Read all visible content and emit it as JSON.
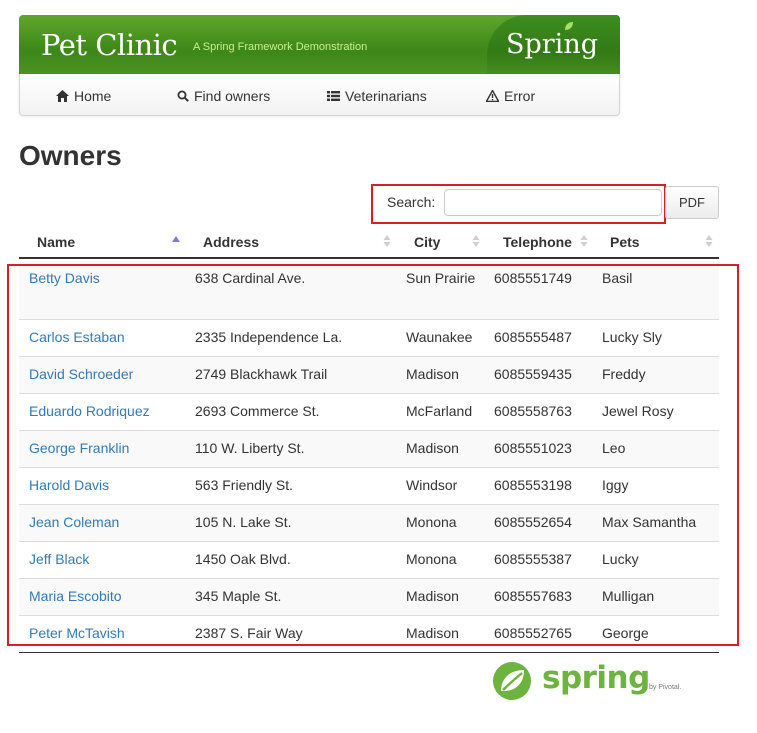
{
  "banner": {
    "title": "Pet Clinic",
    "subtitle": "A Spring Framework Demonstration",
    "logo_text": "Spring"
  },
  "nav": {
    "items": [
      {
        "label": "Home",
        "icon": "home-icon"
      },
      {
        "label": "Find owners",
        "icon": "search-icon"
      },
      {
        "label": "Veterinarians",
        "icon": "list-icon"
      },
      {
        "label": "Error",
        "icon": "warning-icon"
      }
    ]
  },
  "page": {
    "title": "Owners"
  },
  "search": {
    "label": "Search:",
    "value": "",
    "placeholder": ""
  },
  "toolbar": {
    "pdf_label": "PDF"
  },
  "table": {
    "columns": [
      "Name",
      "Address",
      "City",
      "Telephone",
      "Pets"
    ],
    "sorted_column": "Name",
    "rows": [
      {
        "name": "Betty Davis",
        "address": "638 Cardinal Ave.",
        "city": "Sun Prairie",
        "telephone": "6085551749",
        "pets": "Basil"
      },
      {
        "name": "Carlos Estaban",
        "address": "2335 Independence La.",
        "city": "Waunakee",
        "telephone": "6085555487",
        "pets": "Lucky Sly"
      },
      {
        "name": "David Schroeder",
        "address": "2749 Blackhawk Trail",
        "city": "Madison",
        "telephone": "6085559435",
        "pets": "Freddy"
      },
      {
        "name": "Eduardo Rodriquez",
        "address": "2693 Commerce St.",
        "city": "McFarland",
        "telephone": "6085558763",
        "pets": "Jewel Rosy"
      },
      {
        "name": "George Franklin",
        "address": "110 W. Liberty St.",
        "city": "Madison",
        "telephone": "6085551023",
        "pets": "Leo"
      },
      {
        "name": "Harold Davis",
        "address": "563 Friendly St.",
        "city": "Windsor",
        "telephone": "6085553198",
        "pets": "Iggy"
      },
      {
        "name": "Jean Coleman",
        "address": "105 N. Lake St.",
        "city": "Monona",
        "telephone": "6085552654",
        "pets": "Max Samantha"
      },
      {
        "name": "Jeff Black",
        "address": "1450 Oak Blvd.",
        "city": "Monona",
        "telephone": "6085555387",
        "pets": "Lucky"
      },
      {
        "name": "Maria Escobito",
        "address": "345 Maple St.",
        "city": "Madison",
        "telephone": "6085557683",
        "pets": "Mulligan"
      },
      {
        "name": "Peter McTavish",
        "address": "2387 S. Fair Way",
        "city": "Madison",
        "telephone": "6085552765",
        "pets": "George"
      }
    ]
  },
  "footer": {
    "logo_text": "spring",
    "logo_sub": "by Pivotal."
  },
  "colors": {
    "brand_green": "#3f8a1b",
    "link_blue": "#337ab7",
    "highlight_red": "#d42027",
    "sort_active": "#7b7bd8"
  }
}
